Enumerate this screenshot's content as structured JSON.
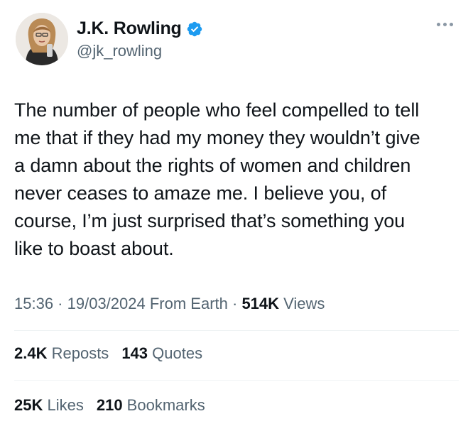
{
  "author": {
    "display_name": "J.K. Rowling",
    "handle": "@jk_rowling",
    "verified_color": "#1d9bf0"
  },
  "tweet": {
    "text": "The number of people who feel compelled to tell\nme that if they had my money they wouldn’t give\na damn about the rights of women and children\nnever ceases to amaze me. I believe you, of\ncourse, I’m just surprised that’s something you\nlike to boast about."
  },
  "meta": {
    "time": "15:36",
    "sep1": " · ",
    "date": "19/03/2024",
    "source": " From Earth",
    "sep2": " · ",
    "views_count": "514K",
    "views_label": " Views"
  },
  "stats_row1": [
    {
      "count": "2.4K",
      "label": " Reposts"
    },
    {
      "count": "143",
      "label": " Quotes"
    }
  ],
  "stats_row2": [
    {
      "count": "25K",
      "label": " Likes"
    },
    {
      "count": "210",
      "label": " Bookmarks"
    }
  ],
  "icons": {
    "more": "more-horizontal-icon",
    "verified": "verified-badge-icon"
  }
}
